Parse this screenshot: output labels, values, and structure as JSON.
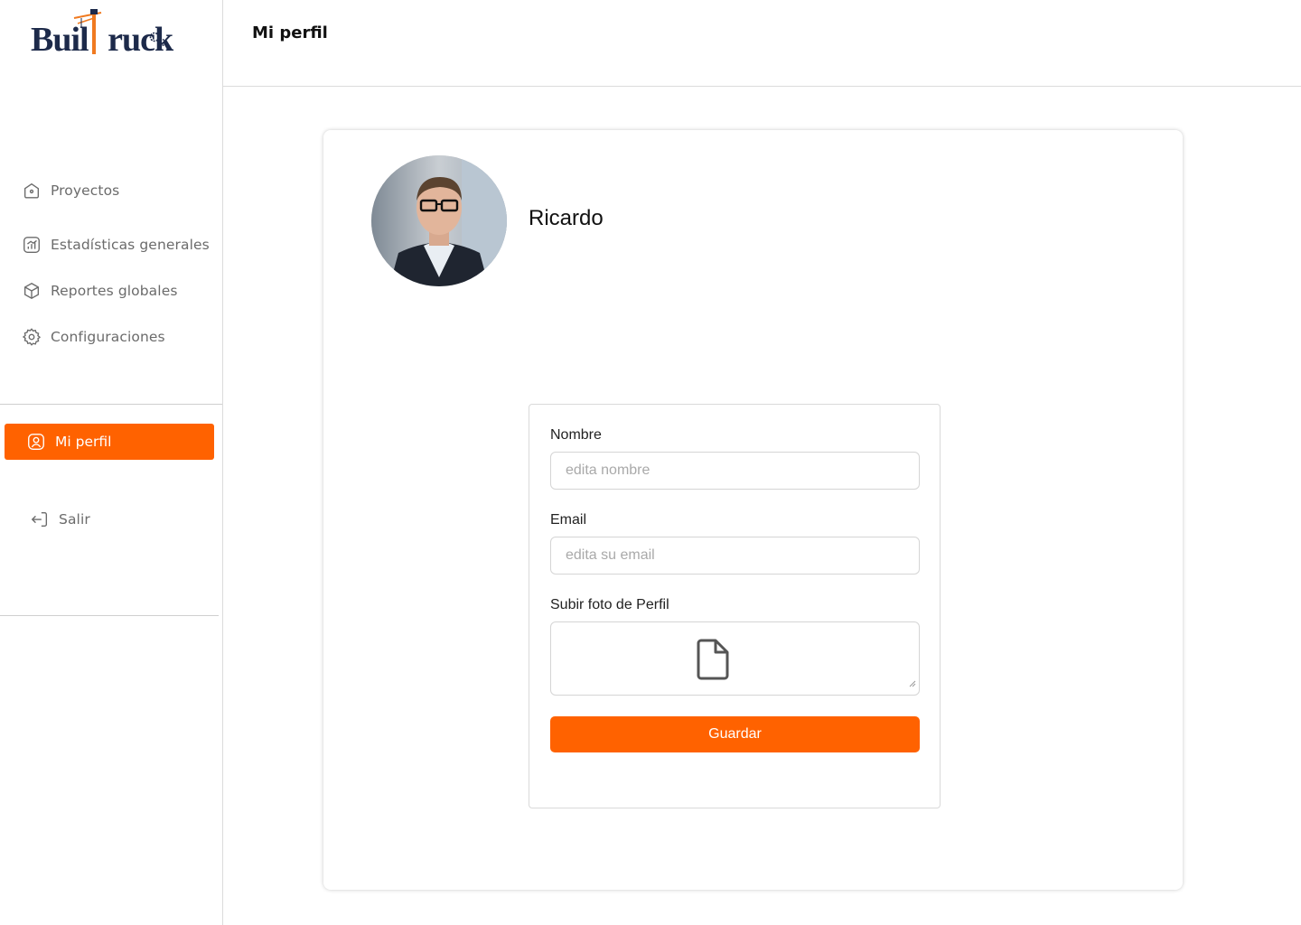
{
  "brand": {
    "name": "BuilTruck",
    "accent_color": "#ff6200"
  },
  "sidebar": {
    "items": [
      {
        "label": "Proyectos",
        "icon": "home-icon"
      },
      {
        "label": "Estadísticas generales",
        "icon": "stats-chart-icon"
      },
      {
        "label": "Reportes globales",
        "icon": "cube-icon"
      },
      {
        "label": "Configuraciones",
        "icon": "gear-icon"
      }
    ],
    "active_item": {
      "label": "Mi perfil",
      "icon": "user-profile-icon"
    },
    "logout": {
      "label": "Salir",
      "icon": "logout-icon"
    }
  },
  "header": {
    "title": "Mi perfil"
  },
  "profile": {
    "name": "Ricardo",
    "avatar": "user-photo"
  },
  "form": {
    "name_label": "Nombre",
    "name_placeholder": "edita nombre",
    "email_label": "Email",
    "email_placeholder": "edita su email",
    "photo_label": "Subir foto de Perfil",
    "upload_icon": "file-icon",
    "save_label": "Guardar"
  }
}
